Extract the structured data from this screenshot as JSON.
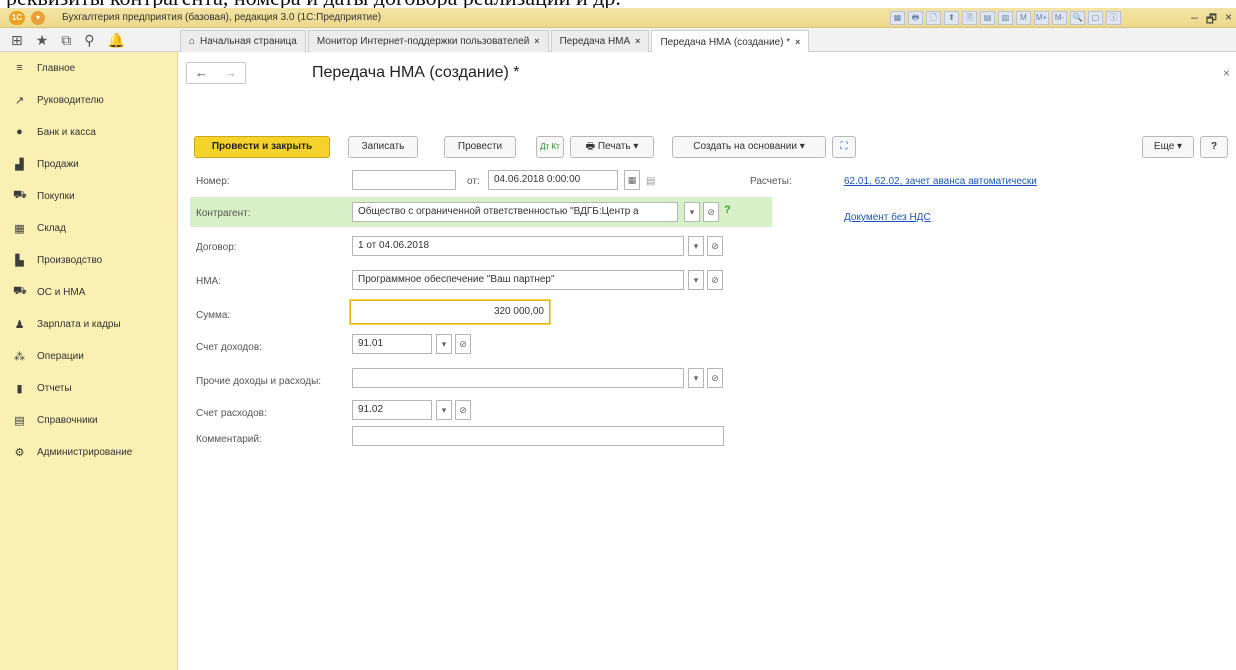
{
  "caption": "реквизиты контрагента, номера и даты договора реализации и др.",
  "window": {
    "title": "Бухгалтерия предприятия (базовая), редакция 3.0 (1С:Предприятие)",
    "logo_text": "1С",
    "menu_glyph": "▾",
    "toolbar_glyphs": [
      "▦",
      "🖶",
      "🗋",
      "⬆",
      "🗎",
      "▤",
      "▥",
      "M",
      "M+",
      "M-",
      "🔍",
      "▢",
      "ⓘ"
    ],
    "controls": [
      "‒",
      "🗗",
      "×"
    ]
  },
  "nav_icons": [
    "apps-grid-icon",
    "star-icon",
    "history-icon",
    "search-icon",
    "bell-icon"
  ],
  "nav_icon_glyphs": [
    "⊞",
    "★",
    "⧉",
    "⚲",
    "🔔"
  ],
  "tabs": [
    {
      "label": "Начальная страница",
      "glyph": "⌂",
      "closable": false
    },
    {
      "label": "Монитор Интернет-поддержки пользователей",
      "closable": true
    },
    {
      "label": "Передача НМА",
      "closable": true
    },
    {
      "label": "Передача НМА (создание) *",
      "closable": true
    }
  ],
  "tab_close": "×",
  "sidebar": {
    "items": [
      {
        "label": "Главное",
        "glyph": "≡"
      },
      {
        "label": "Руководителю",
        "glyph": "↗"
      },
      {
        "label": "Банк и касса",
        "glyph": "●"
      },
      {
        "label": "Продажи",
        "glyph": "▟"
      },
      {
        "label": "Покупки",
        "glyph": "⛟"
      },
      {
        "label": "Склад",
        "glyph": "▦"
      },
      {
        "label": "Производство",
        "glyph": "▙"
      },
      {
        "label": "ОС и НМА",
        "glyph": "⛟"
      },
      {
        "label": "Зарплата и кадры",
        "glyph": "♟"
      },
      {
        "label": "Операции",
        "glyph": "⁂"
      },
      {
        "label": "Отчеты",
        "glyph": "▮"
      },
      {
        "label": "Справочники",
        "glyph": "▤"
      },
      {
        "label": "Администрирование",
        "glyph": "⚙"
      }
    ]
  },
  "header": {
    "back": "←",
    "forward": "→",
    "title": "Передача НМА (создание) *",
    "close": "×"
  },
  "toolbar": {
    "post_close": "Провести и закрыть",
    "save": "Записать",
    "post": "Провести",
    "dt_kt": "Дт Кт",
    "print": "🖶 Печать ▾",
    "create_based": "Создать на основании ▾",
    "structure": "⛶",
    "more": "Еще ▾",
    "help": "?"
  },
  "form": {
    "number_label": "Номер:",
    "number_value": "",
    "date_prefix": "от:",
    "date_value": "04.06.2018 0:00:00",
    "calendar_glyph": "▦",
    "calc_glyph": "▤",
    "settlements_label": "Расчеты:",
    "settlements_link": "62.01, 62.02, зачет аванса автоматически",
    "vat_link": "Документ без НДС",
    "counterparty_label": "Контрагент:",
    "counterparty_value": "Общество с ограниченной ответственностью \"ВДГБ:Центр а",
    "help_mark": "?",
    "contract_label": "Договор:",
    "contract_value": "1 от 04.06.2018",
    "nma_label": "НМА:",
    "nma_value": "Программное обеспечение \"Ваш партнер\"",
    "amount_label": "Сумма:",
    "amount_value": "320 000,00",
    "income_account_label": "Счет доходов:",
    "income_account_value": "91.01",
    "other_label": "Прочие доходы и расходы:",
    "other_value": "",
    "expense_account_label": "Счет расходов:",
    "expense_account_value": "91.02",
    "comment_label": "Комментарий:",
    "comment_value": "",
    "dropdown_glyph": "▾",
    "open_glyph": "⊘"
  }
}
